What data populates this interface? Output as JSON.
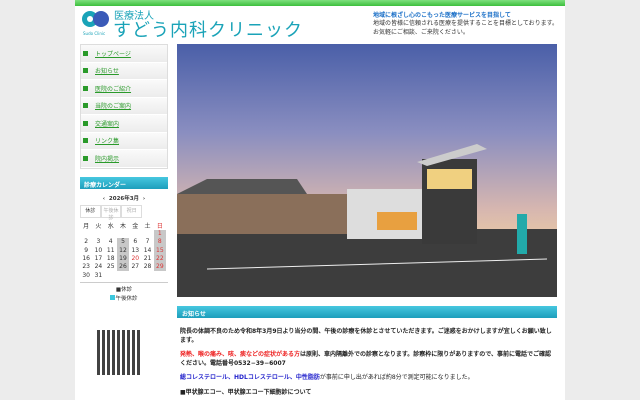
{
  "header": {
    "logo_sub": "医療法人",
    "logo_main": "すどう内科クリニック",
    "logo_mark": "Sudo Clinic",
    "tagline_heading": "地域に根ざし心のこもった医療サービスを目指して",
    "tagline_1": "地域の皆様に信頼される医療を提供することを目標としております。",
    "tagline_2": "お気軽にご相談、ご来院ください。"
  },
  "menu": [
    "トップページ",
    "お知らせ",
    "医院のご紹介",
    "当院のご案内",
    "交通案内",
    "リンク集",
    "院内掲示"
  ],
  "calendar": {
    "title": "診療カレンダー",
    "month": "2026年3月",
    "prev": "‹",
    "next": "›",
    "tabs": [
      "休診",
      "午後休診",
      "祝日"
    ],
    "weekdays": [
      "月",
      "火",
      "水",
      "木",
      "金",
      "土",
      "日"
    ],
    "weeks": [
      [
        "",
        "",
        "",
        "",
        "",
        "",
        "1"
      ],
      [
        "2",
        "3",
        "4",
        "5",
        "6",
        "7",
        "8"
      ],
      [
        "9",
        "10",
        "11",
        "12",
        "13",
        "14",
        "15"
      ],
      [
        "16",
        "17",
        "18",
        "19",
        "20",
        "21",
        "22"
      ],
      [
        "23",
        "24",
        "25",
        "26",
        "27",
        "28",
        "29"
      ],
      [
        "30",
        "31",
        "",
        "",
        "",
        "",
        ""
      ]
    ],
    "legend_closed": "■休診",
    "legend_pm": "午後休診"
  },
  "notice": {
    "title": "お知らせ",
    "p1": "院長の体調不良のため令和8年3月9日より当分の間、午後の診療を休診とさせていただきます。ご迷惑をおかけしますが宜しくお願い致します。",
    "p2_red": "発熱、喉の痛み、咳、痰などの症状がある方",
    "p2": "は原則、車内隔離外での診察となります。診察枠に限りがありますので、事前に電話でご確認ください。電話番号0532−39−6007",
    "p3_blue1": "総コレステロール、HDLコレステロール、中性脂肪",
    "p3": "が事前に申し出があれば約8分で測定可能になりました。",
    "p4": "■甲状腺エコー、甲状腺エコー下細胞診について"
  }
}
